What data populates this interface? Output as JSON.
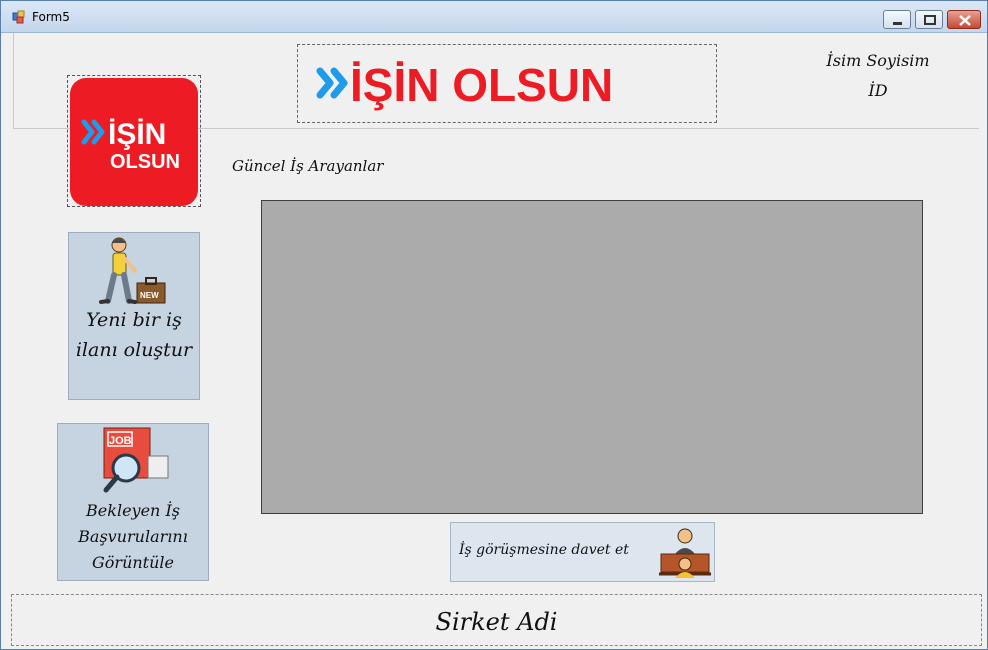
{
  "window": {
    "title": "Form5"
  },
  "brand": {
    "banner_text": "İŞİN OLSUN",
    "square_line1": "İŞİN",
    "square_line2": "OLSUN",
    "red": "#ed1c24",
    "blue": "#1e9be9"
  },
  "user": {
    "name": "İsim Soyisim",
    "id": "İD"
  },
  "main": {
    "section_title": "Güncel İş Arayanlar",
    "grid_color": "#ababab"
  },
  "sidebar": {
    "new_listing_label": "Yeni bir iş ilanı oluştur",
    "new_listing_icon": "job-seeker-icon",
    "new_badge": "NEW",
    "pending_label": "Bekleyen İş Başvurularını Görüntüle",
    "pending_icon": "job-search-icon",
    "job_badge": "JOB"
  },
  "actions": {
    "invite_label": "İş görüşmesine davet et",
    "invite_icon": "interview-icon"
  },
  "footer": {
    "company_name": "Sirket Adi"
  }
}
